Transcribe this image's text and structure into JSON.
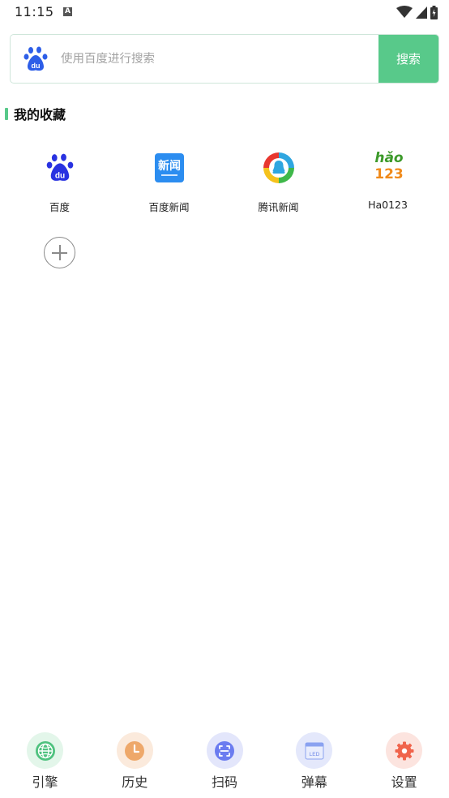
{
  "status_bar": {
    "time": "11:15",
    "notification_letter": "A"
  },
  "search": {
    "placeholder": "使用百度进行搜索",
    "button_label": "搜索",
    "engine_icon": "baidu-paw-icon"
  },
  "favorites": {
    "title": "我的收藏",
    "items": [
      {
        "label": "百度",
        "icon": "baidu-icon"
      },
      {
        "label": "百度新闻",
        "icon": "baidu-news-icon",
        "icon_text": "新闻"
      },
      {
        "label": "腾讯新闻",
        "icon": "tencent-news-icon"
      },
      {
        "label": "Ha0123",
        "icon": "hao123-icon",
        "icon_text_top": "hǎo",
        "icon_text_bottom": "123"
      }
    ],
    "add_icon": "plus-circle-icon"
  },
  "bottom_nav": {
    "items": [
      {
        "label": "引擎",
        "icon": "globe-icon",
        "color": "#4fc27f"
      },
      {
        "label": "历史",
        "icon": "clock-icon",
        "color": "#eea86a"
      },
      {
        "label": "扫码",
        "icon": "scan-icon",
        "color": "#6b7cf0"
      },
      {
        "label": "弹幕",
        "icon": "led-icon",
        "color": "#8aa2f0"
      },
      {
        "label": "设置",
        "icon": "gear-icon",
        "color": "#f0644c"
      }
    ]
  },
  "colors": {
    "accent": "#58c98a"
  }
}
